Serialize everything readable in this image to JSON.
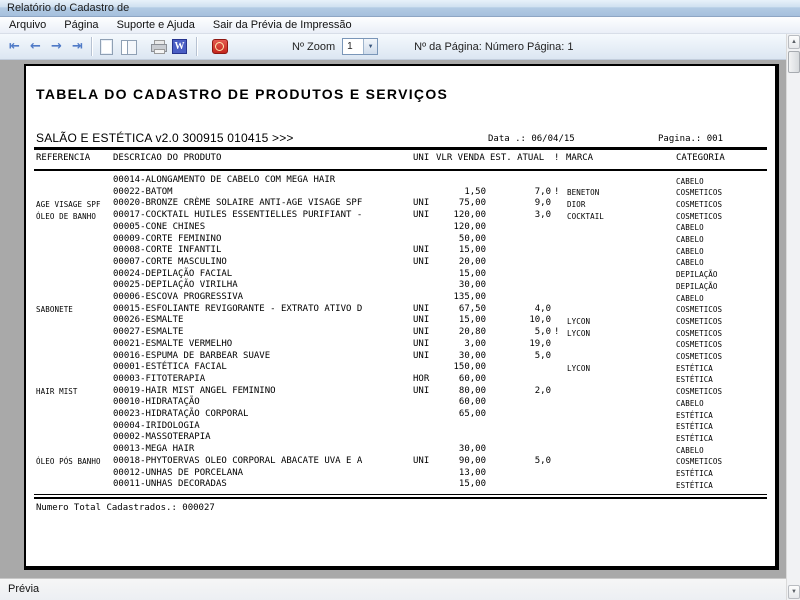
{
  "window": {
    "title": "Relatório do Cadastro de"
  },
  "menubar": {
    "items": [
      "Arquivo",
      "Página",
      "Suporte e Ajuda",
      "Sair da Prévia de Impressão"
    ]
  },
  "toolbar": {
    "nav_buttons": [
      {
        "name": "first-page-button",
        "glyph": "⇤"
      },
      {
        "name": "previous-page-button",
        "glyph": "←"
      },
      {
        "name": "next-page-button",
        "glyph": "→"
      },
      {
        "name": "last-page-button",
        "glyph": "⇥"
      }
    ],
    "word_glyph": "W",
    "zoom_label": "Nº Zoom",
    "zoom_value": "1",
    "zoom_arrow": "▼",
    "page_info": "Nº da Página: Número Página: 1",
    "scroll_up_glyph": "▲",
    "scroll_down_glyph": "▼"
  },
  "report": {
    "title": "TABELA DO CADASTRO DE PRODUTOS E SERVIÇOS",
    "app_line": "SALÃO E ESTÉTICA v2.0 300915 010415 >>>",
    "date_label": "Data .: 06/04/15",
    "page_label": "Pagina.: 001",
    "header": {
      "referencia": "REFERENCIA",
      "descricao": "DESCRICAO DO PRODUTO",
      "uni": "UNI",
      "vlr": "VLR VENDA",
      "est": "EST. ATUAL",
      "flag": "!",
      "marca": "MARCA",
      "categoria": "CATEGORIA"
    },
    "rows": [
      {
        "ref": "",
        "desc": "00014-ALONGAMENTO DE CABELO COM MEGA HAIR",
        "uni": "",
        "vlr": "",
        "est": "",
        "flag": "",
        "marca": "",
        "cat": "CABELO"
      },
      {
        "ref": "",
        "desc": "00022-BATOM",
        "uni": "",
        "vlr": "1,50",
        "est": "7,0",
        "flag": "!",
        "marca": "BENETON",
        "cat": "COSMETICOS"
      },
      {
        "ref": "AGE VISAGE SPF",
        "desc": "00020-BRONZE CRÈME SOLAIRE ANTI-AGE VISAGE SPF",
        "uni": "UNI",
        "vlr": "75,00",
        "est": "9,0",
        "flag": "",
        "marca": "DIOR",
        "cat": "COSMETICOS"
      },
      {
        "ref": "ÓLEO DE BANHO",
        "desc": "00017-COCKTAIL HUILES ESSENTIELLES PURIFIANT -",
        "uni": "UNI",
        "vlr": "120,00",
        "est": "3,0",
        "flag": "",
        "marca": "COCKTAIL",
        "cat": "COSMETICOS"
      },
      {
        "ref": "",
        "desc": "00005-CONE CHINES",
        "uni": "",
        "vlr": "120,00",
        "est": "",
        "flag": "",
        "marca": "",
        "cat": "CABELO"
      },
      {
        "ref": "",
        "desc": "00009-CORTE FEMININO",
        "uni": "",
        "vlr": "50,00",
        "est": "",
        "flag": "",
        "marca": "",
        "cat": "CABELO"
      },
      {
        "ref": "",
        "desc": "00008-CORTE INFANTIL",
        "uni": "UNI",
        "vlr": "15,00",
        "est": "",
        "flag": "",
        "marca": "",
        "cat": "CABELO"
      },
      {
        "ref": "",
        "desc": "00007-CORTE MASCULINO",
        "uni": "UNI",
        "vlr": "20,00",
        "est": "",
        "flag": "",
        "marca": "",
        "cat": "CABELO"
      },
      {
        "ref": "",
        "desc": "00024-DEPILAÇÃO FACIAL",
        "uni": "",
        "vlr": "15,00",
        "est": "",
        "flag": "",
        "marca": "",
        "cat": "DEPILAÇÃO"
      },
      {
        "ref": "",
        "desc": "00025-DEPILAÇÃO VIRILHA",
        "uni": "",
        "vlr": "30,00",
        "est": "",
        "flag": "",
        "marca": "",
        "cat": "DEPILAÇÃO"
      },
      {
        "ref": "",
        "desc": "00006-ESCOVA PROGRESSIVA",
        "uni": "",
        "vlr": "135,00",
        "est": "",
        "flag": "",
        "marca": "",
        "cat": "CABELO"
      },
      {
        "ref": "SABONETE",
        "desc": "00015-ESFOLIANTE REVIGORANTE - EXTRATO ATIVO D",
        "uni": "UNI",
        "vlr": "67,50",
        "est": "4,0",
        "flag": "",
        "marca": "",
        "cat": "COSMETICOS"
      },
      {
        "ref": "",
        "desc": "00026-ESMALTE",
        "uni": "UNI",
        "vlr": "15,00",
        "est": "10,0",
        "flag": "",
        "marca": "LYCON",
        "cat": "COSMETICOS"
      },
      {
        "ref": "",
        "desc": "00027-ESMALTE",
        "uni": "UNI",
        "vlr": "20,80",
        "est": "5,0",
        "flag": "!",
        "marca": "LYCON",
        "cat": "COSMETICOS"
      },
      {
        "ref": "",
        "desc": "00021-ESMALTE VERMELHO",
        "uni": "UNI",
        "vlr": "3,00",
        "est": "19,0",
        "flag": "",
        "marca": "",
        "cat": "COSMETICOS"
      },
      {
        "ref": "",
        "desc": "00016-ESPUMA DE BARBEAR SUAVE",
        "uni": "UNI",
        "vlr": "30,00",
        "est": "5,0",
        "flag": "",
        "marca": "",
        "cat": "COSMETICOS"
      },
      {
        "ref": "",
        "desc": "00001-ESTÉTICA FACIAL",
        "uni": "",
        "vlr": "150,00",
        "est": "",
        "flag": "",
        "marca": "LYCON",
        "cat": "ESTÉTICA"
      },
      {
        "ref": "",
        "desc": "00003-FITOTERAPIA",
        "uni": "HOR",
        "vlr": "60,00",
        "est": "",
        "flag": "",
        "marca": "",
        "cat": "ESTÉTICA"
      },
      {
        "ref": "HAIR MIST",
        "desc": "00019-HAIR MIST ANGEL FEMININO",
        "uni": "UNI",
        "vlr": "80,00",
        "est": "2,0",
        "flag": "",
        "marca": "",
        "cat": "COSMETICOS"
      },
      {
        "ref": "",
        "desc": "00010-HIDRATAÇÃO",
        "uni": "",
        "vlr": "60,00",
        "est": "",
        "flag": "",
        "marca": "",
        "cat": "CABELO"
      },
      {
        "ref": "",
        "desc": "00023-HIDRATAÇÃO CORPORAL",
        "uni": "",
        "vlr": "65,00",
        "est": "",
        "flag": "",
        "marca": "",
        "cat": "ESTÉTICA"
      },
      {
        "ref": "",
        "desc": "00004-IRIDOLOGIA",
        "uni": "",
        "vlr": "",
        "est": "",
        "flag": "",
        "marca": "",
        "cat": "ESTÉTICA"
      },
      {
        "ref": "",
        "desc": "00002-MASSOTERAPIA",
        "uni": "",
        "vlr": "",
        "est": "",
        "flag": "",
        "marca": "",
        "cat": "ESTÉTICA"
      },
      {
        "ref": "",
        "desc": "00013-MEGA HAIR",
        "uni": "",
        "vlr": "30,00",
        "est": "",
        "flag": "",
        "marca": "",
        "cat": "CABELO"
      },
      {
        "ref": "ÓLEO PÓS BANHO",
        "desc": "00018-PHYTOERVAS OLEO CORPORAL ABACATE UVA E A",
        "uni": "UNI",
        "vlr": "90,00",
        "est": "5,0",
        "flag": "",
        "marca": "",
        "cat": "COSMETICOS"
      },
      {
        "ref": "",
        "desc": "00012-UNHAS DE PORCELANA",
        "uni": "",
        "vlr": "13,00",
        "est": "",
        "flag": "",
        "marca": "",
        "cat": "ESTÉTICA"
      },
      {
        "ref": "",
        "desc": "00011-UNHAS DECORADAS",
        "uni": "",
        "vlr": "15,00",
        "est": "",
        "flag": "",
        "marca": "",
        "cat": "ESTÉTICA"
      }
    ],
    "footer": "Numero Total Cadastrados.: 000027"
  },
  "statusbar": {
    "label": "Prévia"
  },
  "colors": {
    "nav_arrow_blue": "#4f7ac7",
    "word_icon_blue": "#4a5ec4",
    "exit_icon_red": "#c3261d",
    "preview_background": "#a9a9a9",
    "paper": "#ffffff"
  }
}
